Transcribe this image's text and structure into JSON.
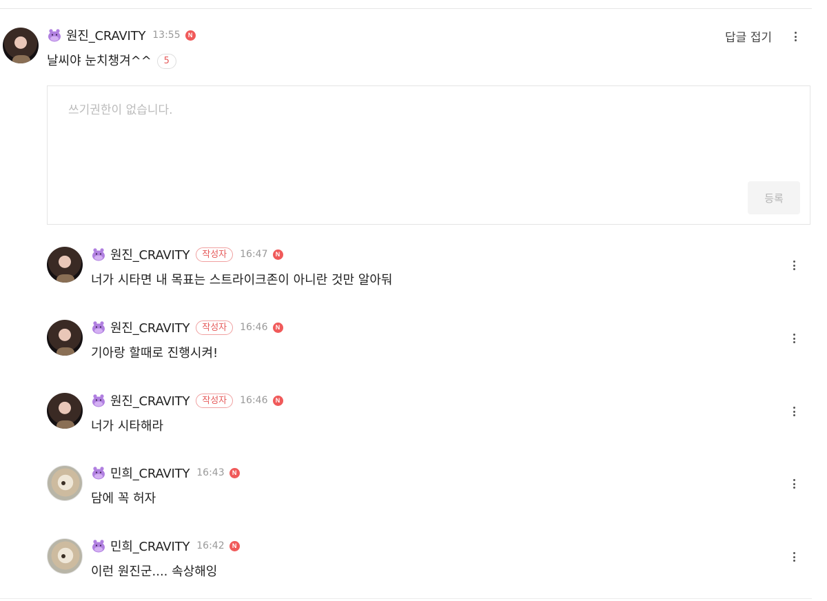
{
  "root_comment": {
    "nickname": "원진_CRAVITY",
    "time": "13:55",
    "text": "날씨야 눈치챙겨^^",
    "reply_count": "5",
    "fold_label": "답글 접기"
  },
  "editor": {
    "placeholder": "쓰기권한이 없습니다.",
    "submit_label": "등록"
  },
  "replies": [
    {
      "nickname": "원진_CRAVITY",
      "writer_badge": "작성자",
      "time": "16:47",
      "text": "너가 시타면 내 목표는 스트라이크존이 아니란 것만 알아둬",
      "avatar": "dark"
    },
    {
      "nickname": "원진_CRAVITY",
      "writer_badge": "작성자",
      "time": "16:46",
      "text": "기아랑 할때로 진행시켜!",
      "avatar": "dark"
    },
    {
      "nickname": "원진_CRAVITY",
      "writer_badge": "작성자",
      "time": "16:46",
      "text": "너가 시타해라",
      "avatar": "dark"
    },
    {
      "nickname": "민희_CRAVITY",
      "time": "16:43",
      "text": "담에 꼭 허자",
      "avatar": "dog"
    },
    {
      "nickname": "민희_CRAVITY",
      "time": "16:42",
      "text": "이런 원진군.... 속상해잉",
      "avatar": "dog"
    }
  ],
  "icons": {
    "member_badge": "purple-hippo-icon",
    "naver": "n-icon",
    "more": "more-vertical-icon"
  },
  "colors": {
    "accent_red": "#f05a5a",
    "badge_purple": "#b07fe0"
  }
}
